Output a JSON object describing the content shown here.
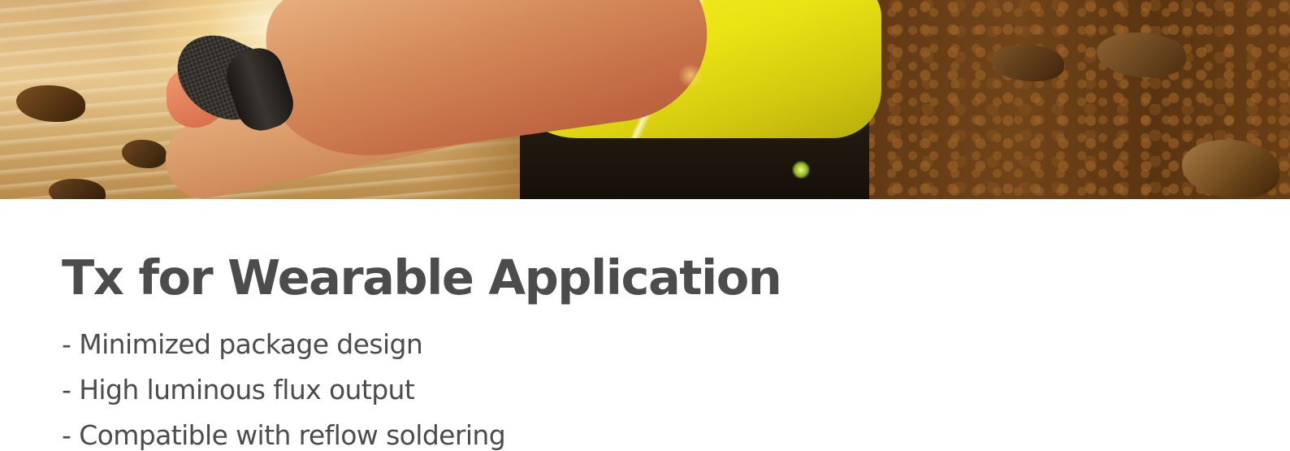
{
  "hero": {
    "image_description_icon": "cyclist-hero-image"
  },
  "main": {
    "title": "Tx for Wearable Application",
    "features": [
      "- Minimized package design",
      "- High luminous flux output",
      "- Compatible with reflow soldering"
    ]
  },
  "colors": {
    "text": "#4c4c4c",
    "background": "#ffffff",
    "jersey_yellow": "#f7f22a"
  }
}
